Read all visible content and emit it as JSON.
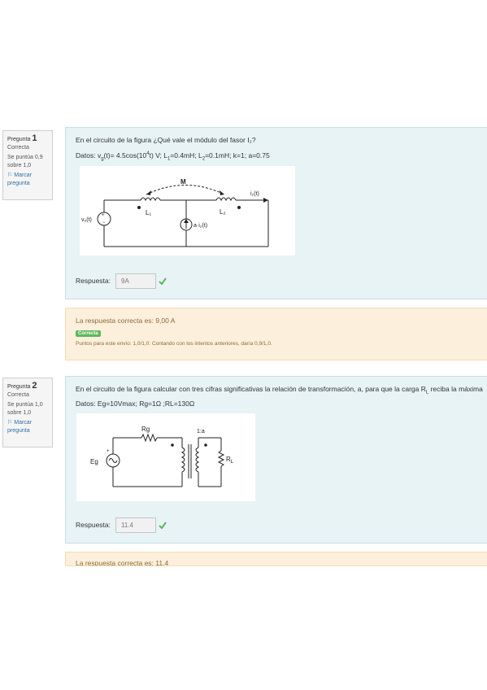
{
  "questions": [
    {
      "info": {
        "label": "Pregunta",
        "number": "1",
        "state": "Correcta",
        "grade_line1": "Se puntúa 0,9",
        "grade_line2": "sobre 1,0",
        "flag_line1": "Marcar",
        "flag_line2": "pregunta"
      },
      "text": "En el circuito de la figura ¿Qué vale el módulo del fasor I₂?",
      "datos_prefix": "Datos:",
      "datos_vg": "v",
      "datos_vg_sub": "g",
      "datos_vg_rest": "(t)= 4.5cos(10",
      "datos_exp": "4",
      "datos_rest": "t)  V;  L",
      "datos_l1_sub": "1",
      "datos_l1_val": "=0.4mH;  L",
      "datos_l2_sub": "2",
      "datos_l2_val": "=0.1mH;  k=1;  a=0.75",
      "figure_labels": {
        "mutual": "M",
        "l1": "L₁",
        "l2": "L₂",
        "source": "v₉(t)",
        "dep_source": "a·i₂(t)",
        "current": "i₂(t)"
      },
      "answer_label": "Respuesta:",
      "answer_value": "9A",
      "feedback": {
        "correct_answer": "La respuesta correcta es: 9,00 A",
        "badge": "Correcta",
        "grade": "Puntos para este envío: 1,0/1,0. Contando con los intentos anteriores, daría 0,9/1,0."
      }
    },
    {
      "info": {
        "label": "Pregunta",
        "number": "2",
        "state": "Correcta",
        "grade_line1": "Se puntúa 1,0",
        "grade_line2": "sobre 1,0",
        "flag_line1": "Marcar",
        "flag_line2": "pregunta"
      },
      "text": "En el circuito de la figura calcular con tres cifras significativas la relación de transformación, a, para que la carga R",
      "text_sub": "L",
      "text_rest": " reciba la máxima",
      "datos": "Datos: Eg=10Vmax; Rg=1Ω ;RL=130Ω",
      "figure_labels": {
        "rg": "Rg",
        "ratio": "1:a",
        "eg": "Eg",
        "rl": "R",
        "rl_sub": "L"
      },
      "answer_label": "Respuesta:",
      "answer_value": "11.4",
      "feedback": {
        "correct_answer": "La respuesta correcta es: 11,4"
      }
    }
  ],
  "colors": {
    "question_bg": "#e7f3f5",
    "feedback_bg": "#fcefdc",
    "correct_green": "#5cb85c",
    "link_blue": "#2f6fa5"
  }
}
